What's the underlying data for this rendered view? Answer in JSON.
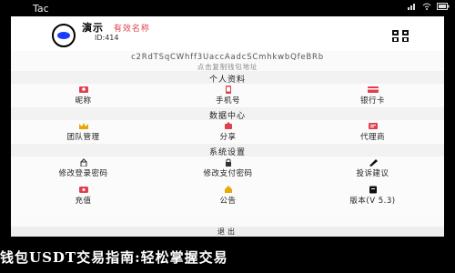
{
  "statusbar": {
    "time": "Tac"
  },
  "profile": {
    "name": "演示",
    "badge": "有效名称",
    "uid": "ID:414"
  },
  "address": {
    "value": "c2RdTSqCWhff3UaccAadcSCmhkwbQfeBRb",
    "hint": "点击复制钱包地址"
  },
  "sections": [
    {
      "title": "个人资料",
      "items": [
        {
          "label": "昵称",
          "icon": "profile-icon",
          "color": "#e0404e"
        },
        {
          "label": "手机号",
          "icon": "phone-icon",
          "color": "#e0404e"
        },
        {
          "label": "银行卡",
          "icon": "bank-card-icon",
          "color": "#e0404e"
        }
      ]
    },
    {
      "title": "数据中心",
      "items": [
        {
          "label": "团队管理",
          "icon": "crown-icon",
          "color": "#e8a800"
        },
        {
          "label": "分享",
          "icon": "share-icon",
          "color": "#e0404e"
        },
        {
          "label": "代理商",
          "icon": "agent-icon",
          "color": "#e0404e"
        }
      ]
    },
    {
      "title": "系统设置",
      "items": [
        {
          "label": "修改登录密码",
          "icon": "login-lock-icon",
          "color": "#333333"
        },
        {
          "label": "修改支付密码",
          "icon": "pay-lock-icon",
          "color": "#333333"
        },
        {
          "label": "投诉建议",
          "icon": "feedback-icon",
          "color": "#111111"
        }
      ]
    },
    {
      "title": "",
      "items": [
        {
          "label": "充值",
          "icon": "recharge-icon",
          "color": "#e0404e"
        },
        {
          "label": "公告",
          "icon": "notice-icon",
          "color": "#e8a800"
        },
        {
          "label": "版本(V 5.3)",
          "icon": "version-icon",
          "color": "#111111"
        }
      ]
    }
  ],
  "logout": {
    "label": "退出"
  },
  "caption": "钱包USDT交易指南:轻松掌握交易"
}
